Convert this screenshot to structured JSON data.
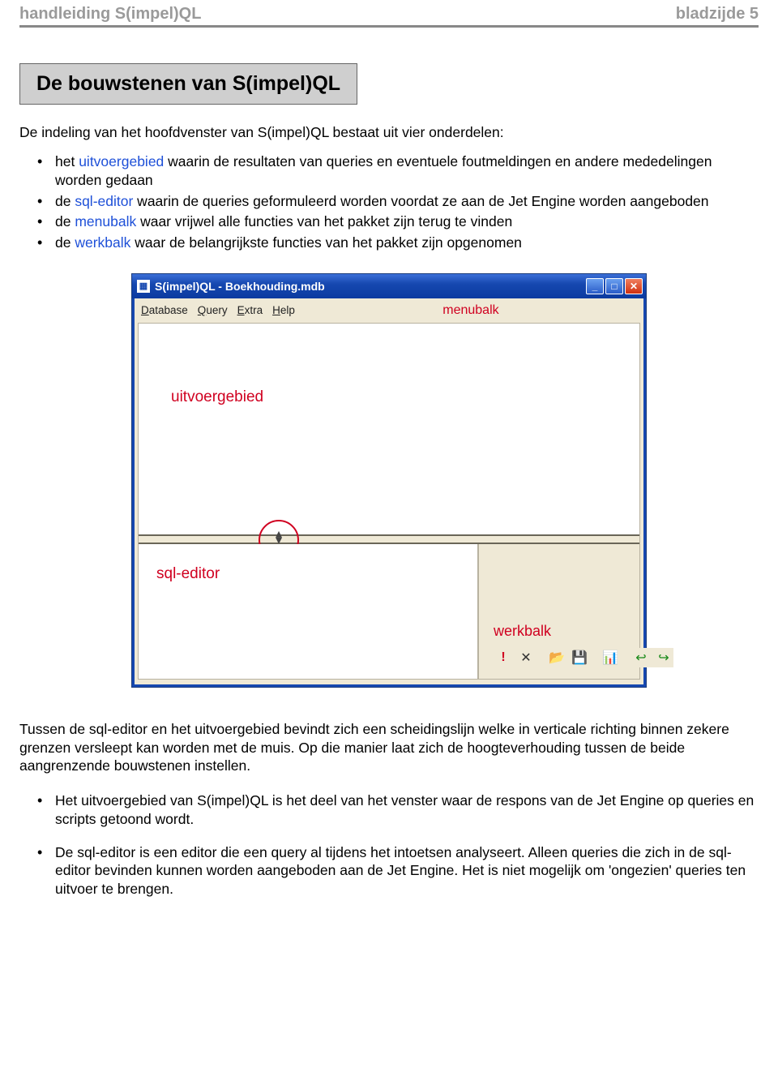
{
  "header": {
    "left": "handleiding S(impel)QL",
    "right": "bladzijde 5"
  },
  "section_title": "De bouwstenen van S(impel)QL",
  "intro": "De indeling van het hoofdvenster van S(impel)QL bestaat uit vier onderdelen:",
  "bullets": [
    {
      "pre": "het ",
      "link": "uitvoergebied",
      "post": " waarin de resultaten van queries en eventuele foutmeldingen en andere mededelingen worden gedaan"
    },
    {
      "pre": "de ",
      "link": "sql-editor",
      "post": " waarin de queries geformuleerd worden voordat ze aan de Jet Engine worden aangeboden"
    },
    {
      "pre": "de ",
      "link": "menubalk",
      "post": " waar vrijwel alle functies van het pakket zijn terug te vinden"
    },
    {
      "pre": "de ",
      "link": "werkbalk",
      "post": " waar de belangrijkste functies van het pakket zijn opgenomen"
    }
  ],
  "window": {
    "title": "S(impel)QL - Boekhouding.mdb",
    "menus": {
      "database": "Database",
      "query": "Query",
      "extra": "Extra",
      "help": "Help"
    },
    "labels": {
      "menubalk": "menubalk",
      "uitvoergebied": "uitvoergebied",
      "sql_editor": "sql-editor",
      "werkbalk": "werkbalk"
    },
    "icons": {
      "exclaim": "!",
      "close": "✕",
      "open": "📂",
      "save": "💾",
      "chart": "📊",
      "undo": "↩",
      "redo": "↪"
    }
  },
  "para1": "Tussen de sql-editor en het uitvoergebied bevindt zich een scheidingslijn welke in verticale richting binnen zekere grenzen versleept kan worden met de muis. Op die manier laat zich de hoogteverhouding tussen de beide aangrenzende bouwstenen instellen.",
  "bottom_bullets": [
    "Het uitvoergebied van S(impel)QL is het deel van het venster waar de respons van de Jet Engine op queries en scripts getoond wordt.",
    "De sql-editor is een editor die een query al tijdens het intoetsen analyseert. Alleen queries die zich in de sql-editor bevinden kunnen worden aangeboden aan de Jet Engine. Het is niet mogelijk om 'ongezien' queries ten uitvoer te brengen."
  ]
}
